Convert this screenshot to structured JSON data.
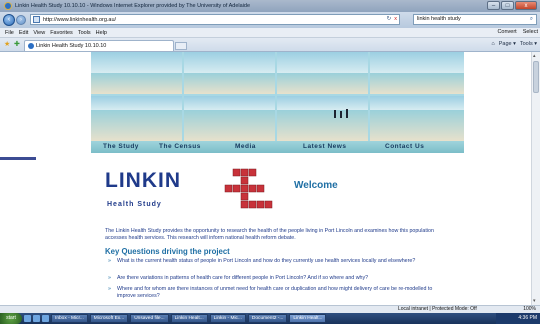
{
  "window": {
    "title": "Linkin Health Study 10.10.10 - Windows Internet Explorer provided by The University of Adelaide",
    "controls": {
      "minimize": "–",
      "maximize": "□",
      "close": "x"
    }
  },
  "navbar": {
    "back": "‹",
    "forward": "›",
    "address": "http://www.linkinhealth.org.au/",
    "refresh": "↻",
    "stop": "x",
    "search_value": "linkin health study",
    "search_icon": "⌕"
  },
  "menu": {
    "items": [
      "File",
      "Edit",
      "View",
      "Favorites",
      "Tools",
      "Help"
    ],
    "right": [
      "Convert",
      "Select"
    ]
  },
  "tabs": {
    "active_tab": "Linkin Health Study 10.10.10",
    "tools": [
      "Page ▾",
      "Tools ▾"
    ]
  },
  "site": {
    "nav": [
      "The Study",
      "The Census",
      "Media",
      "Latest News",
      "Contact Us"
    ],
    "logo_text": "LINKIN",
    "logo_subtitle": "Health Study",
    "welcome": "Welcome",
    "intro": "The Linkin Health Study provides the opportunity to research the health of the people living in Port Lincoln and examines how this population accesses health services. This research will inform national health reform debate.",
    "questions_heading": "Key Questions driving the project",
    "questions": [
      "What is the current health status of people in Port Lincoln and how do they currently use health services locally and elsewhere?",
      "Are there variations in patterns of health care for different people in Port Lincoln? And if so where and why?",
      "Where and for whom are there instances of unmet need for health care or duplication and how might delivery of care be re-modelled to improve services?"
    ],
    "arrow": "»"
  },
  "status": {
    "zone": "Local intranet | Protected Mode: Off",
    "zoom": "100%"
  },
  "taskbar": {
    "start": "start",
    "buttons": [
      "Inbox - Micr...",
      "Microsoft Ex...",
      "Unsaved file...",
      "Linkin Healt...",
      "Linkin - Mic...",
      "Document2 -...",
      "Linkin Healt..."
    ],
    "time": "4:36 PM"
  },
  "colors": {
    "site_nav_bg": "#7bbdc8",
    "site_link": "#1f3a8a",
    "heading": "#1f6fa4",
    "taskbar": "#18325b"
  }
}
